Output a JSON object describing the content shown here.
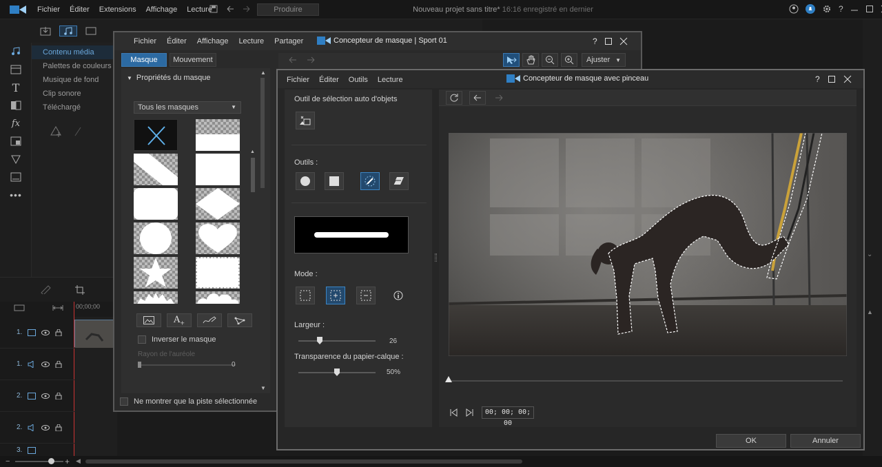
{
  "main": {
    "menu": [
      "Fichier",
      "Éditer",
      "Extensions",
      "Affichage",
      "Lecture"
    ],
    "produce_label": "Produire",
    "project_title": "Nouveau projet sans titre*",
    "project_saved": "16:16 enregistré en dernier"
  },
  "library": {
    "items": [
      "Contenu média",
      "Palettes de couleurs",
      "Musique de fond",
      "Clip sonore",
      "Téléchargé"
    ],
    "active_index": 0
  },
  "timeline": {
    "ruler_start": "00;00;00",
    "tracks": [
      "1.",
      "1.",
      "2.",
      "2.",
      "3."
    ]
  },
  "mask_designer": {
    "menu": [
      "Fichier",
      "Éditer",
      "Affichage",
      "Lecture",
      "Partager"
    ],
    "title": "Concepteur de masque  |  Sport 01",
    "tabs": [
      "Masque",
      "Mouvement"
    ],
    "properties_title": "Propriétés du masque",
    "mask_filter": "Tous les masques",
    "invert_label": "Inverser le masque",
    "halo_label": "Rayon de l'auréole",
    "halo_value": "0",
    "show_selected_label": "Ne montrer que la piste sélectionnée",
    "adjust_label": "Ajuster"
  },
  "brush_designer": {
    "menu": [
      "Fichier",
      "Éditer",
      "Outils",
      "Lecture"
    ],
    "title": "Concepteur de masque avec pinceau",
    "auto_select_label": "Outil de sélection auto d'objets",
    "tools_label": "Outils :",
    "mode_label": "Mode :",
    "width_label": "Largeur :",
    "width_value": "26",
    "width_fraction": 0.26,
    "tracing_label": "Transparence du papier-calque :",
    "tracing_value": "50%",
    "tracing_fraction": 0.5,
    "timecode": "00; 00; 00; 00",
    "ok_label": "OK",
    "cancel_label": "Annuler"
  },
  "colors": {
    "accent": "#2c6aa2",
    "active_tool": "#3b86c6"
  }
}
